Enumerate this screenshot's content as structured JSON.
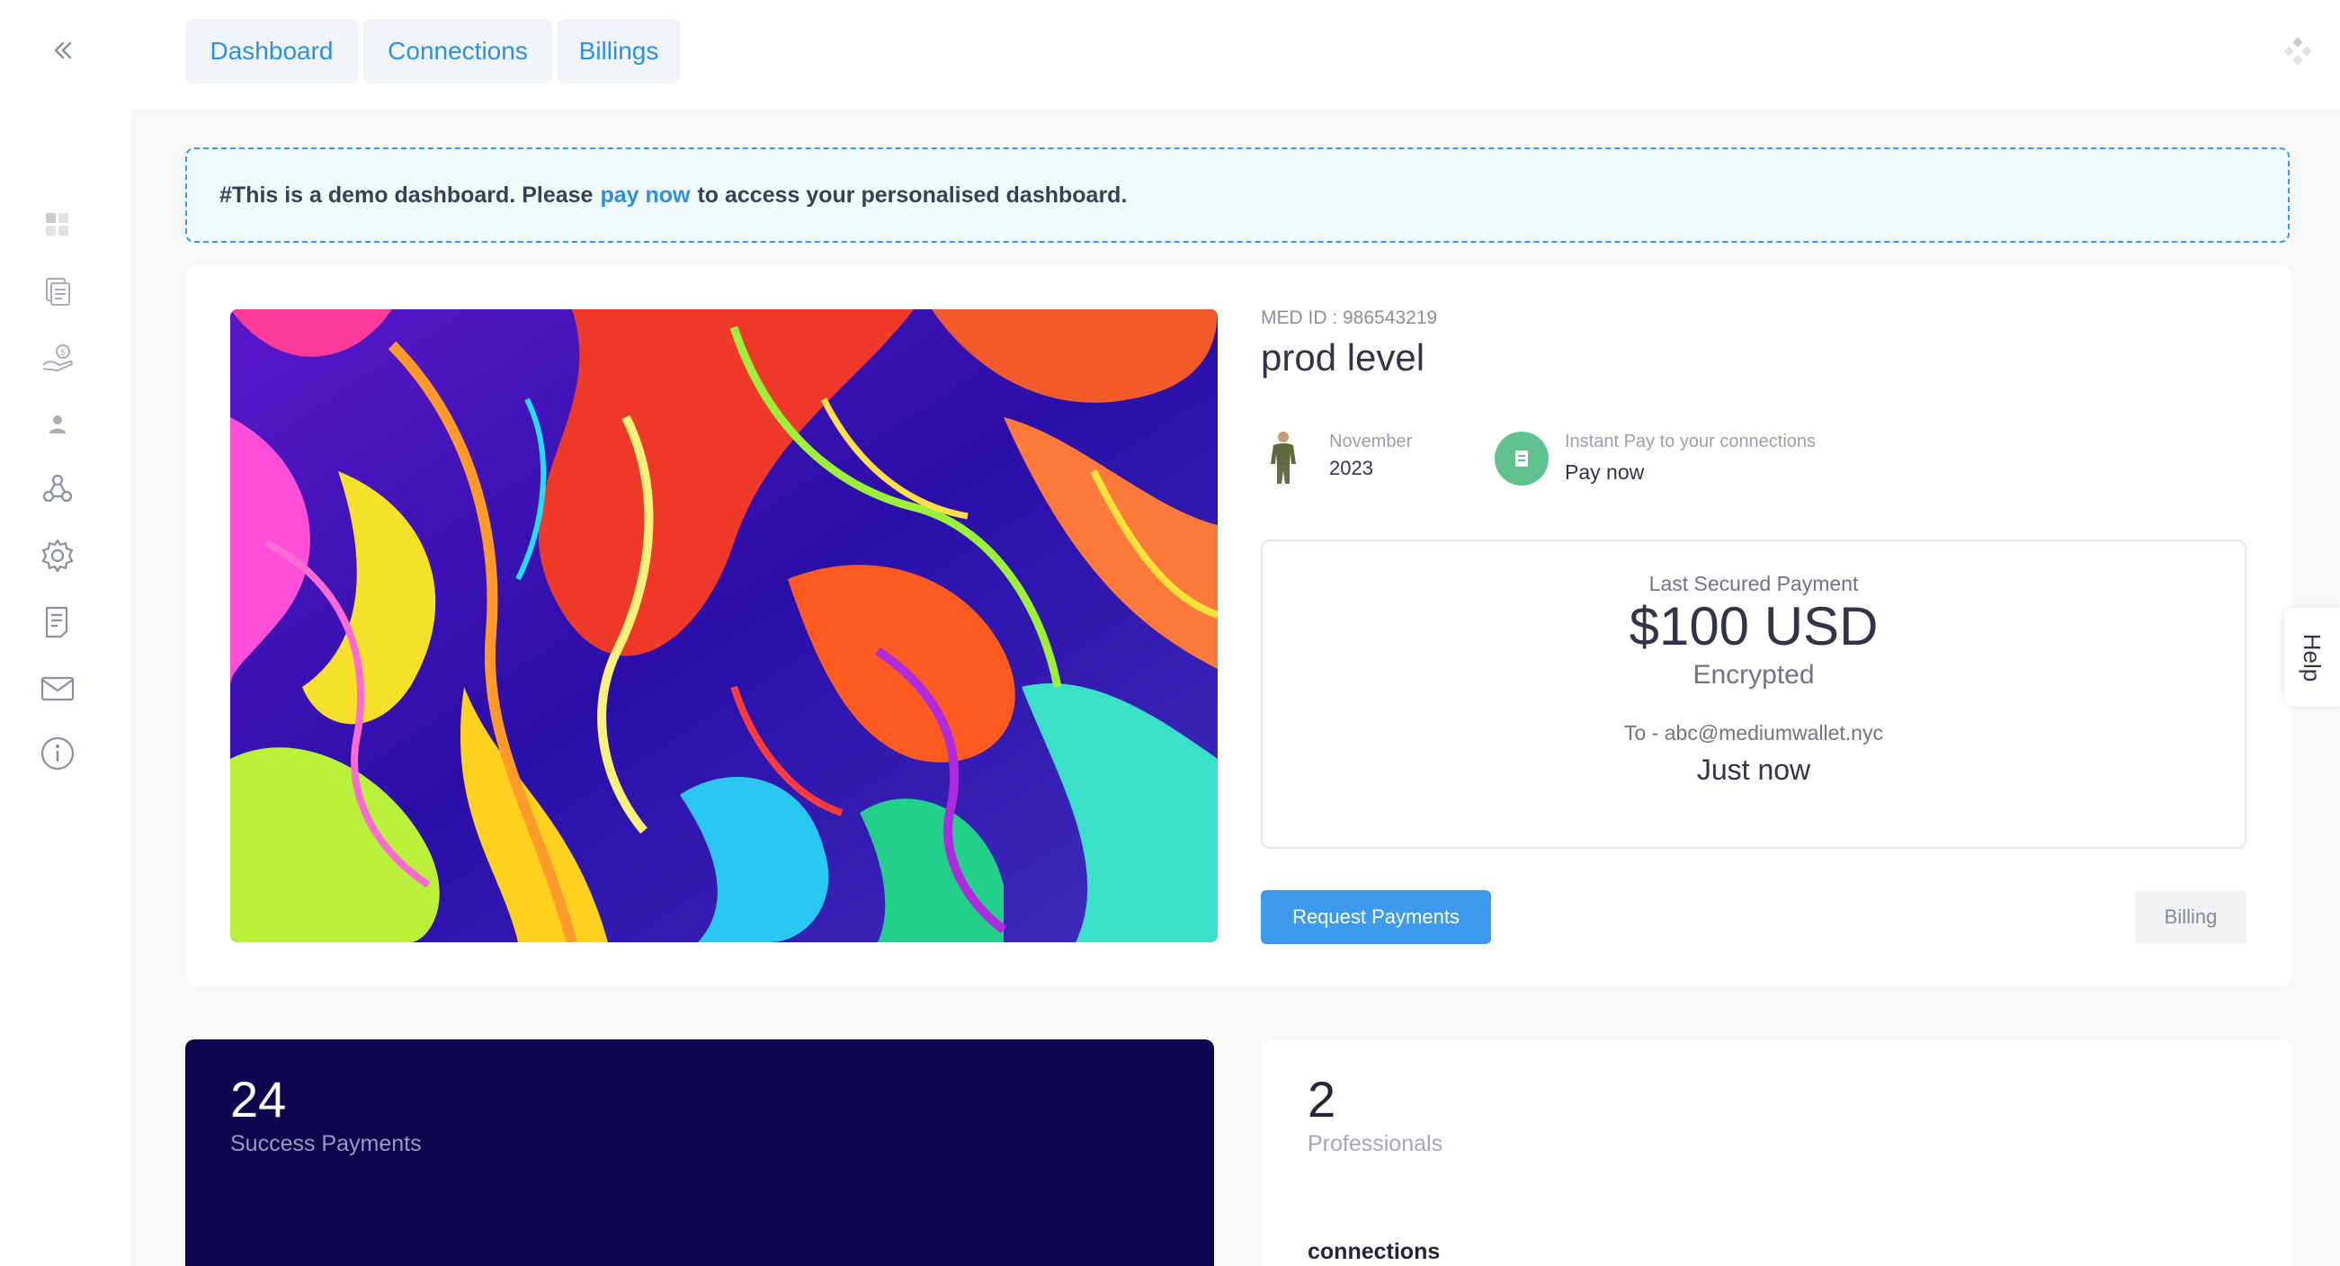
{
  "nav": {
    "tabs": [
      {
        "label": "Dashboard"
      },
      {
        "label": "Connections"
      },
      {
        "label": "Billings"
      }
    ]
  },
  "sidebar": {
    "icons": [
      "dashboard-icon",
      "invoice-icon",
      "payments-icon",
      "user-icon",
      "network-icon",
      "settings-icon",
      "reports-icon",
      "mail-icon",
      "info-icon"
    ]
  },
  "banner": {
    "prefix": "#This is a demo dashboard. Please",
    "link": "pay now",
    "suffix": "to access your personalised dashboard."
  },
  "profile": {
    "med_id": "MED ID : 986543219",
    "title": "prod level",
    "date_month": "November",
    "date_year": "2023",
    "instant_pay_label": "Instant Pay to your connections",
    "pay_now": "Pay now"
  },
  "last_payment": {
    "title": "Last Secured Payment",
    "amount": "$100 USD",
    "status": "Encrypted",
    "to": "To - abc@mediumwallet.nyc",
    "time": "Just now"
  },
  "actions": {
    "request": "Request Payments",
    "billing": "Billing"
  },
  "stats": {
    "success_count": "24",
    "success_label": "Success Payments",
    "pro_count": "2",
    "pro_label": "Professionals",
    "connections_label": "connections"
  },
  "help": {
    "label": "Help"
  },
  "colors": {
    "accent": "#2f8fe0",
    "button": "#3d9bef",
    "dark_card": "#0d064f",
    "pay_green": "#5fc38f"
  }
}
